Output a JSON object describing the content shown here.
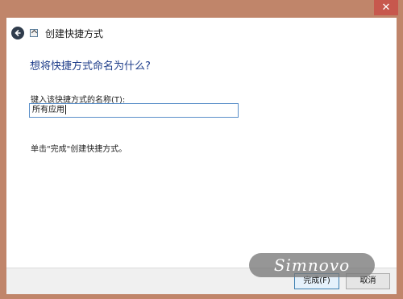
{
  "window": {
    "title": "创建快捷方式",
    "close_symbol": "✕"
  },
  "page": {
    "heading": "想将快捷方式命名为什么?",
    "name_label": "键入该快捷方式的名称(T):",
    "name_value": "所有应用",
    "instruction": "单击\"完成\"创建快捷方式。"
  },
  "footer": {
    "finish_label": "完成(F)",
    "cancel_label": "取消"
  },
  "watermark": {
    "text": "Simnovo"
  },
  "icons": {
    "back": "back-arrow-icon",
    "wizard": "shortcut-icon"
  },
  "colors": {
    "frame": "#c0856a",
    "heading": "#1e3d8a",
    "input_border": "#5a8fc9",
    "close_button": "#c7584d"
  }
}
